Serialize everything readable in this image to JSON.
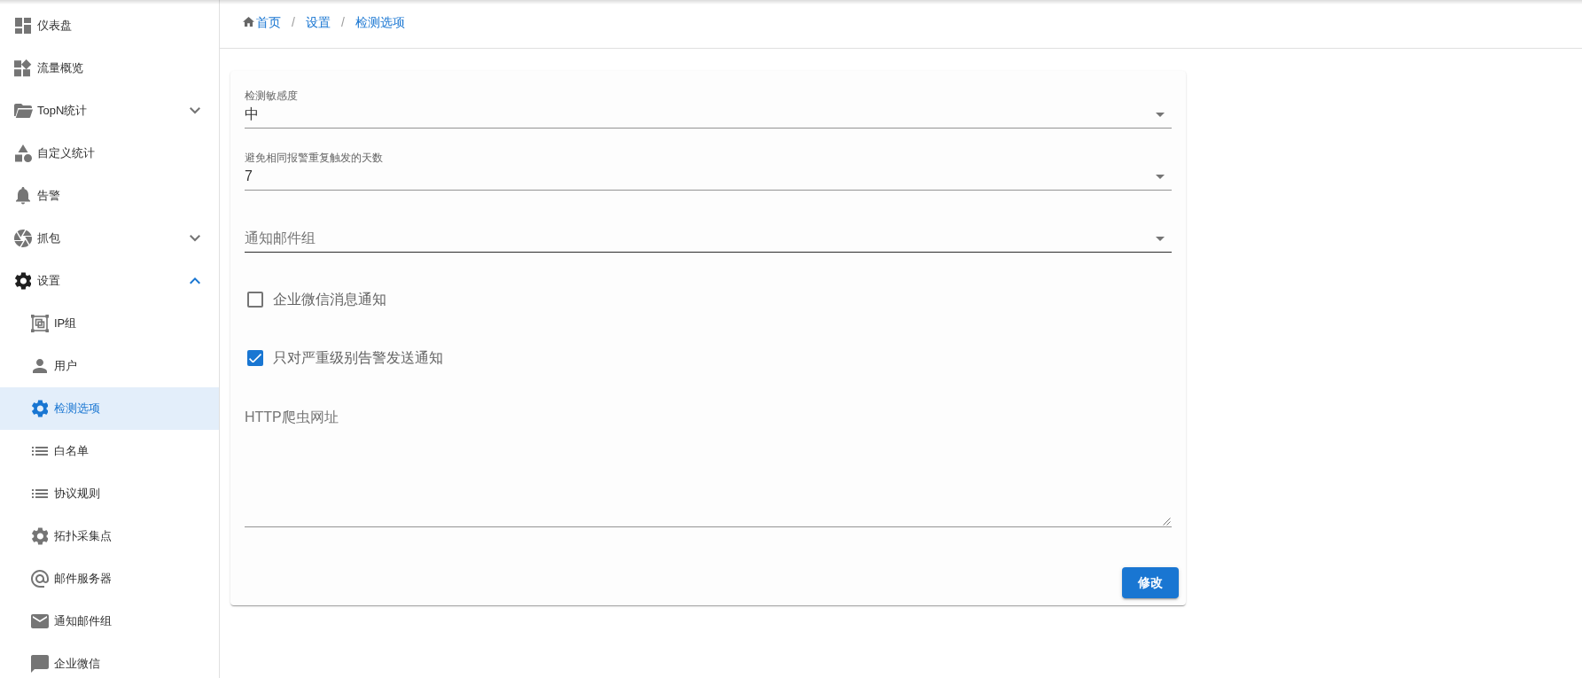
{
  "sidebar": {
    "items": [
      {
        "label": "仪表盘",
        "kind": "link",
        "selected": false
      },
      {
        "label": "流量概览",
        "kind": "link",
        "selected": false
      },
      {
        "label": "TopN统计",
        "kind": "group",
        "expanded": false,
        "selected": false
      },
      {
        "label": "自定义统计",
        "kind": "link",
        "selected": false
      },
      {
        "label": "告警",
        "kind": "link",
        "selected": false
      },
      {
        "label": "抓包",
        "kind": "group",
        "expanded": false,
        "selected": false
      },
      {
        "label": "设置",
        "kind": "group",
        "expanded": true,
        "selected": false,
        "children": [
          {
            "label": "IP组",
            "selected": false
          },
          {
            "label": "用户",
            "selected": false
          },
          {
            "label": "检测选项",
            "selected": true
          },
          {
            "label": "白名单",
            "selected": false
          },
          {
            "label": "协议规则",
            "selected": false
          },
          {
            "label": "拓扑采集点",
            "selected": false
          },
          {
            "label": "邮件服务器",
            "selected": false
          },
          {
            "label": "通知邮件组",
            "selected": false
          },
          {
            "label": "企业微信",
            "selected": false
          }
        ]
      }
    ]
  },
  "breadcrumb": {
    "items": [
      {
        "label": "首页"
      },
      {
        "label": "设置"
      },
      {
        "label": "检测选项"
      }
    ],
    "separators": [
      "/",
      "/"
    ]
  },
  "form": {
    "selects": [
      {
        "label": "检测敏感度",
        "value": "中",
        "hovered": false
      },
      {
        "label": "避免相同报警重复触发的天数",
        "value": "7",
        "hovered": false
      },
      {
        "label": "通知邮件组",
        "hovered": true
      }
    ],
    "checkboxes": [
      {
        "label": "企业微信消息通知",
        "checked": false
      },
      {
        "label": "只对严重级别告警发送通知",
        "checked": true
      }
    ],
    "textarea": {
      "label": "HTTP爬虫网址"
    },
    "submit_button": "修改"
  }
}
